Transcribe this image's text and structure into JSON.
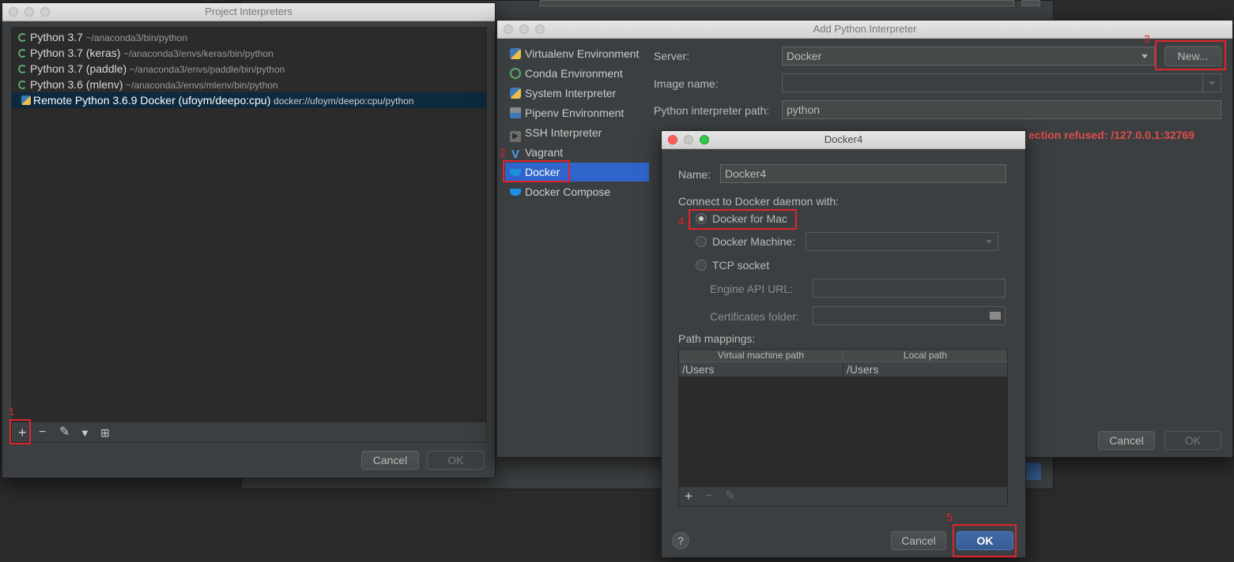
{
  "project_interpreters": {
    "title": "Project Interpreters",
    "items": [
      {
        "name": "Python 3.7",
        "path": "~/anaconda3/bin/python"
      },
      {
        "name": "Python 3.7 (keras)",
        "path": "~/anaconda3/envs/keras/bin/python"
      },
      {
        "name": "Python 3.7 (paddle)",
        "path": "~/anaconda3/envs/paddle/bin/python"
      },
      {
        "name": "Python 3.6 (mlenv)",
        "path": "~/anaconda3/envs/mlenv/bin/python"
      },
      {
        "name": "Remote Python 3.6.9 Docker (ufoym/deepo:cpu)",
        "path": "docker://ufoym/deepo:cpu/python"
      }
    ],
    "toolbar": {
      "add": "+",
      "remove": "−",
      "edit": "✎",
      "filter": "▼",
      "tree": "⊞"
    },
    "cancel": "Cancel",
    "ok": "OK"
  },
  "add_interpreter": {
    "title": "Add Python Interpreter",
    "sidebar": [
      {
        "label": "Virtualenv Environment",
        "icon": "python-icon"
      },
      {
        "label": "Conda Environment",
        "icon": "conda-icon"
      },
      {
        "label": "System Interpreter",
        "icon": "python-icon"
      },
      {
        "label": "Pipenv Environment",
        "icon": "pipenv-icon"
      },
      {
        "label": "SSH Interpreter",
        "icon": "terminal-icon"
      },
      {
        "label": "Vagrant",
        "icon": "vagrant-icon"
      },
      {
        "label": "Docker",
        "icon": "docker-icon"
      },
      {
        "label": "Docker Compose",
        "icon": "docker-icon"
      }
    ],
    "selected": "Docker",
    "server_label": "Server:",
    "server_value": "Docker",
    "new_button": "New...",
    "image_label": "Image name:",
    "image_value": "",
    "path_label": "Python interpreter path:",
    "path_value": "python",
    "error_text": "ection refused: /127.0.0.1:32769",
    "cancel": "Cancel",
    "ok": "OK"
  },
  "docker_dialog": {
    "title": "Docker4",
    "name_label": "Name:",
    "name_value": "Docker4",
    "connect_label": "Connect to Docker daemon with:",
    "opt_mac": "Docker for Mac",
    "opt_machine": "Docker Machine:",
    "opt_tcp": "TCP socket",
    "engine_label": "Engine API URL:",
    "cert_label": "Certificates folder:",
    "mappings_label": "Path mappings:",
    "col_vm": "Virtual machine path",
    "col_local": "Local path",
    "rows": [
      {
        "vm": "/Users",
        "local": "/Users"
      }
    ],
    "help": "?",
    "cancel": "Cancel",
    "ok": "OK"
  },
  "annotations": [
    "1",
    "2",
    "3",
    "4",
    "5"
  ],
  "colors": {
    "accent": "#2f65ca",
    "annotation": "#e0242c",
    "error": "#e04b4b"
  }
}
